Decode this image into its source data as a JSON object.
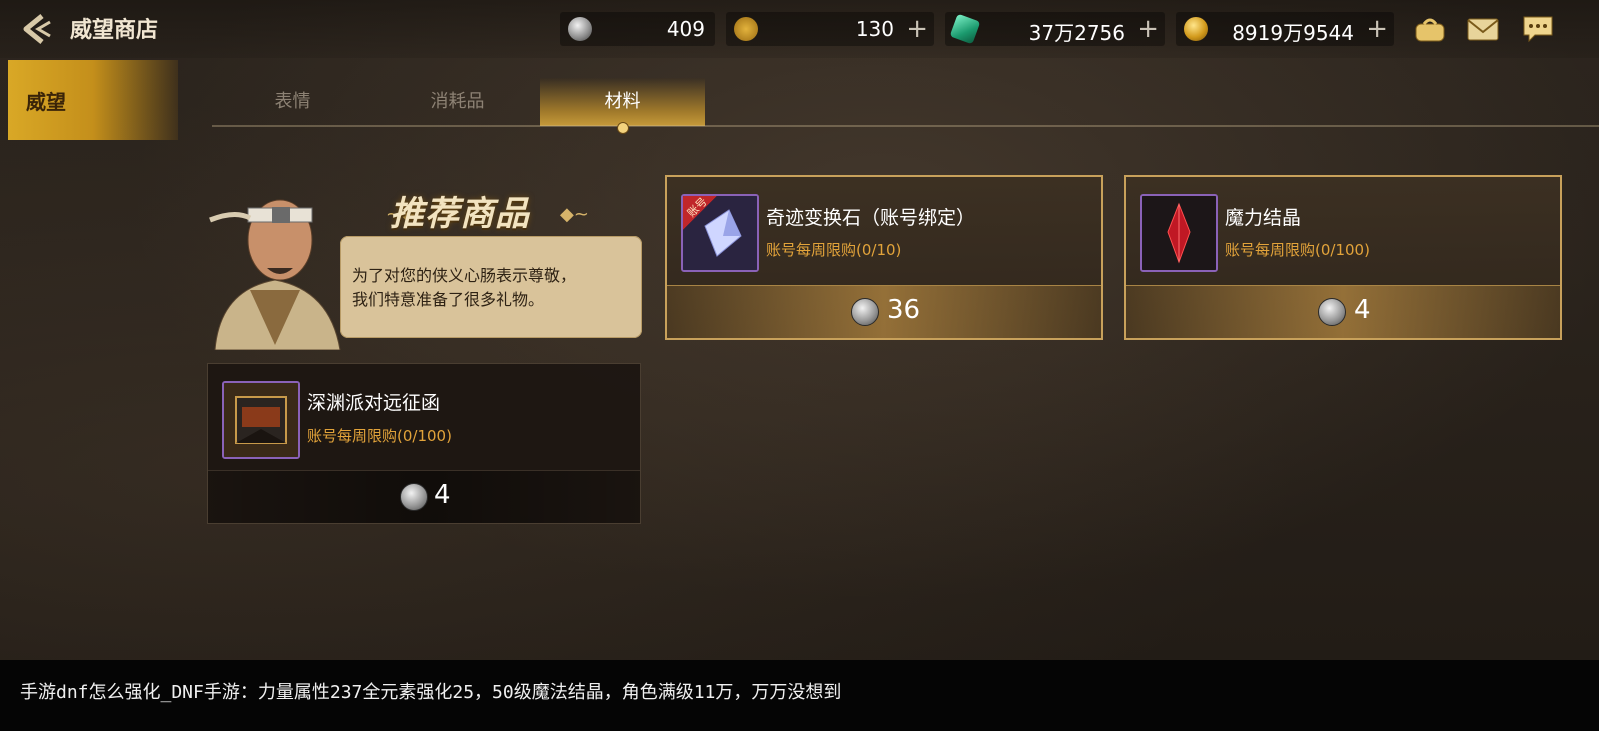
{
  "header": {
    "title": "威望商店",
    "currencies": [
      {
        "icon": "prestige-coin-icon",
        "value": "409",
        "has_plus": false
      },
      {
        "icon": "c-coin-icon",
        "value": "130",
        "has_plus": true
      },
      {
        "icon": "green-gem-icon",
        "value": "37万2756",
        "has_plus": true
      },
      {
        "icon": "gold-coin-icon",
        "value": "8919万9544",
        "has_plus": true
      }
    ],
    "plus_symbol": "+",
    "icons": [
      "bag-icon",
      "mail-icon",
      "chat-icon"
    ]
  },
  "nav": {
    "active": "威望"
  },
  "tabs": [
    {
      "label": "表情",
      "active": false
    },
    {
      "label": "消耗品",
      "active": false
    },
    {
      "label": "材料",
      "active": true
    }
  ],
  "recommend": {
    "title": "推荐商品",
    "dialog": "为了对您的侠义心肠表示尊敬，\n我们特意准备了很多礼物。"
  },
  "items": [
    {
      "name": "奇迹变换石（账号绑定）",
      "limit": "账号每周限购(0/10)",
      "price": "36",
      "badge": "账号",
      "icon": "crystal-stone-icon"
    },
    {
      "name": "魔力结晶",
      "limit": "账号每周限购(0/100)",
      "price": "4",
      "icon": "red-crystal-icon"
    },
    {
      "name": "深渊派对远征函",
      "limit": "账号每周限购(0/100)",
      "price": "4",
      "icon": "letter-icon"
    }
  ],
  "caption": "手游dnf怎么强化_DNF手游：力量属性237全元素强化25，50级魔法结晶，角色满级11万，万万没想到",
  "colors": {
    "accent": "#c8a15b",
    "limit": "#e2a33a",
    "nav_active": "#d9a826"
  }
}
